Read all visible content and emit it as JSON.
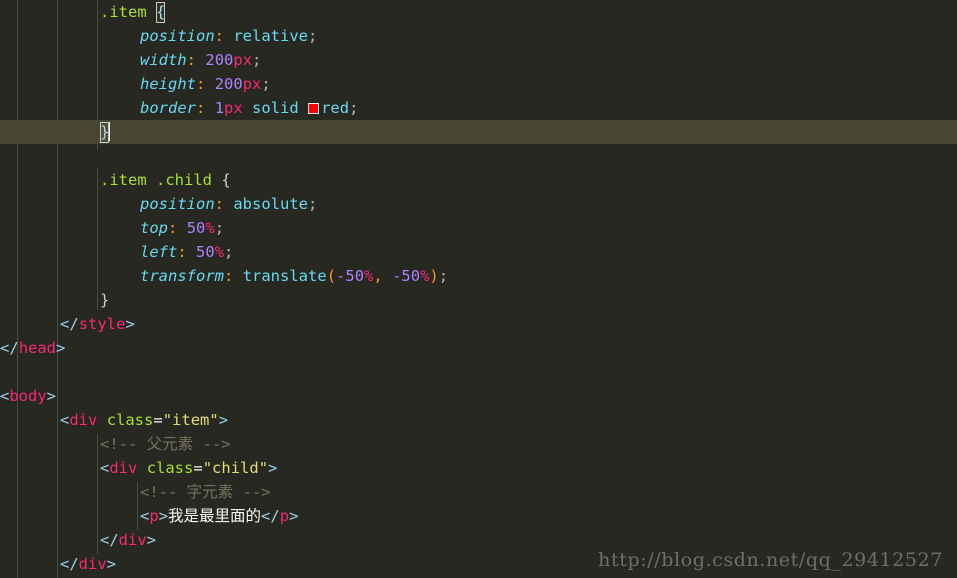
{
  "editor": {
    "background": "#272822",
    "current_line_background": "#464632",
    "indent_guide_color": "#4a4a42",
    "font_size_px": 15.5,
    "line_height_px": 24
  },
  "palette": {
    "selector_green": "#a6e22e",
    "property_cyan": "#66d9ef",
    "punctuation_orange": "#fd971f",
    "number_purple": "#ae81ff",
    "unit_crimson": "#f92672",
    "string_yellow": "#e6db74",
    "tag_bracket_blue": "#9cd0e8",
    "comment_gray": "#75715e",
    "plain_text": "#f8f8f2",
    "swatch_red": "#ff0000"
  },
  "lines": {
    "l1_selector": ".item",
    "l1_open_brace": "{",
    "l2_prop": "position",
    "l2_colon": ":",
    "l2_value": "relative",
    "l2_semi": ";",
    "l3_prop": "width",
    "l3_colon": ":",
    "l3_num": "200",
    "l3_unit": "px",
    "l3_semi": ";",
    "l4_prop": "height",
    "l4_colon": ":",
    "l4_num": "200",
    "l4_unit": "px",
    "l4_semi": ";",
    "l5_prop": "border",
    "l5_colon": ":",
    "l5_num": "1",
    "l5_unit": "px",
    "l5_solid": "solid",
    "l5_color": "red",
    "l5_semi": ";",
    "l6_close_brace": "}",
    "l8_selector": ".item .child",
    "l8_open_brace": "{",
    "l9_prop": "position",
    "l9_colon": ":",
    "l9_value": "absolute",
    "l9_semi": ";",
    "l10_prop": "top",
    "l10_colon": ":",
    "l10_num": "50",
    "l10_unit": "%",
    "l10_semi": ";",
    "l11_prop": "left",
    "l11_colon": ":",
    "l11_num": "50",
    "l11_unit": "%",
    "l11_semi": ";",
    "l12_prop": "transform",
    "l12_colon": ":",
    "l12_fn": "translate",
    "l12_paren_open": "(",
    "l12_num_a": "-50",
    "l12_unit_a": "%",
    "l12_comma": ",",
    "l12_num_b": "-50",
    "l12_unit_b": "%",
    "l12_paren_close": ")",
    "l12_semi": ";",
    "l13_close_brace": "}",
    "l14_lt": "<",
    "l14_slash": "/",
    "l14_tag": "style",
    "l14_gt": ">",
    "l15_lt": "<",
    "l15_slash": "/",
    "l15_tag": "head",
    "l15_gt": ">",
    "l17_lt": "<",
    "l17_tag": "body",
    "l17_gt": ">",
    "l18_lt": "<",
    "l18_tag": "div",
    "l18_attr": "class",
    "l18_eq": "=",
    "l18_str": "\"item\"",
    "l18_gt": ">",
    "l19_comment": "<!-- 父元素 -->",
    "l20_lt": "<",
    "l20_tag": "div",
    "l20_attr": "class",
    "l20_eq": "=",
    "l20_str": "\"child\"",
    "l20_gt": ">",
    "l21_comment": "<!-- 字元素 -->",
    "l22_lt": "<",
    "l22_tag": "p",
    "l22_gt": ">",
    "l22_text": "我是最里面的",
    "l22_lt_close": "</",
    "l22_tag_close": "p",
    "l22_gt_close": ">",
    "l23_lt": "</",
    "l23_tag": "div",
    "l23_gt": ">",
    "l24_lt": "</",
    "l24_tag": "div",
    "l24_gt": ">"
  },
  "watermark": {
    "text": "http://blog.csdn.net/qq_29412527"
  }
}
